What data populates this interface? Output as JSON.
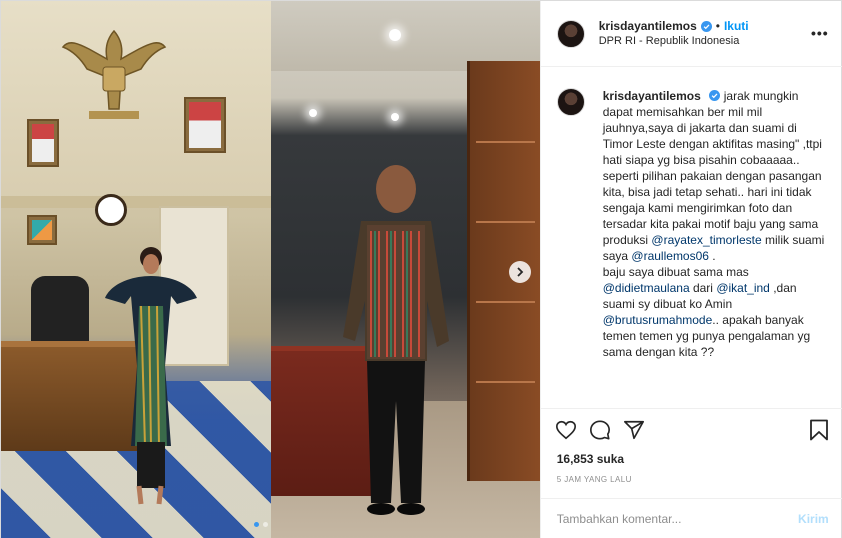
{
  "post": {
    "username": "krisdayantilemos",
    "follow_label": "Ikuti",
    "separator": "•",
    "location": "DPR RI - Republik Indonesia",
    "more_label": "•••"
  },
  "caption": {
    "username": "krisdayantilemos",
    "segments": [
      {
        "type": "text",
        "value": "jarak mungkin dapat memisahkan ber mil mil jauhnya,saya di jakarta dan suami di Timor Leste dengan aktifitas masing\" ,ttpi hati siapa yg bisa pisahin cobaaaaa.."
      },
      {
        "type": "break"
      },
      {
        "type": "text",
        "value": "seperti pilihan pakaian dengan pasangan kita, bisa jadi tetap sehati.. hari ini tidak sengaja kami mengirimkan foto dan tersadar kita pakai motif baju yang sama produksi "
      },
      {
        "type": "mention",
        "value": "@rayatex_timorleste"
      },
      {
        "type": "text",
        "value": " milik suami saya "
      },
      {
        "type": "mention",
        "value": "@raullemos06"
      },
      {
        "type": "text",
        "value": " ."
      },
      {
        "type": "break"
      },
      {
        "type": "text",
        "value": "baju saya dibuat sama mas "
      },
      {
        "type": "mention",
        "value": "@didietmaulana"
      },
      {
        "type": "text",
        "value": " dari "
      },
      {
        "type": "mention",
        "value": "@ikat_ind"
      },
      {
        "type": "text",
        "value": " ,dan suami sy dibuat ko Amin "
      },
      {
        "type": "mention",
        "value": "@brutusrumahmode"
      },
      {
        "type": "text",
        "value": ".. apakah banyak temen temen yg punya pengalaman yg sama dengan kita ??"
      }
    ]
  },
  "engagement": {
    "likes": "16,853 suka",
    "timestamp": "5 JAM YANG LALU"
  },
  "comment": {
    "placeholder": "Tambahkan komentar...",
    "post_label": "Kirim"
  },
  "carousel": {
    "slide_count": 2,
    "active_index": 0
  },
  "icons": {
    "verified": "verified-badge-icon",
    "like": "heart-icon",
    "comment": "comment-bubble-icon",
    "share": "paper-plane-icon",
    "save": "bookmark-icon",
    "next": "chevron-right-icon"
  },
  "colors": {
    "link": "#0095f6",
    "mention": "#00376b",
    "muted": "#8e8e8e",
    "post_button": "#b2dffc",
    "border": "#efefef"
  }
}
